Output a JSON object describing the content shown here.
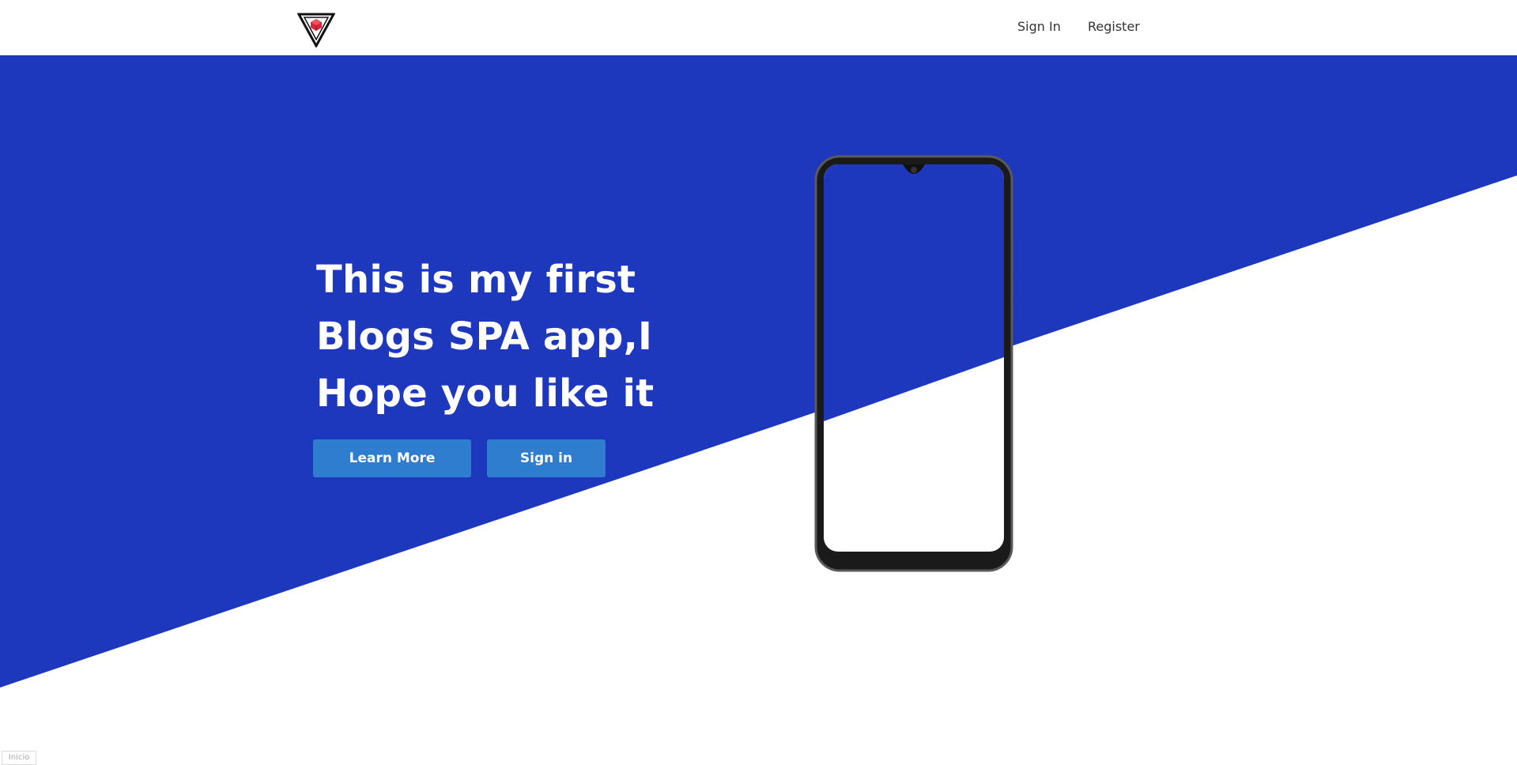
{
  "header": {
    "nav": {
      "signin_label": "Sign In",
      "register_label": "Register"
    }
  },
  "hero": {
    "title": "This is my first Blogs SPA app,I Hope you like it",
    "learn_more_label": "Learn More",
    "signin_label": "Sign in"
  },
  "footer": {
    "corner_label": "Inicio"
  },
  "colors": {
    "hero_blue": "#1e38bd",
    "button_blue": "#2f7dcf",
    "background": "#ffffff"
  },
  "icons": {
    "logo": "triangle-cube-logo-icon",
    "phone": "smartphone-mockup-icon"
  }
}
